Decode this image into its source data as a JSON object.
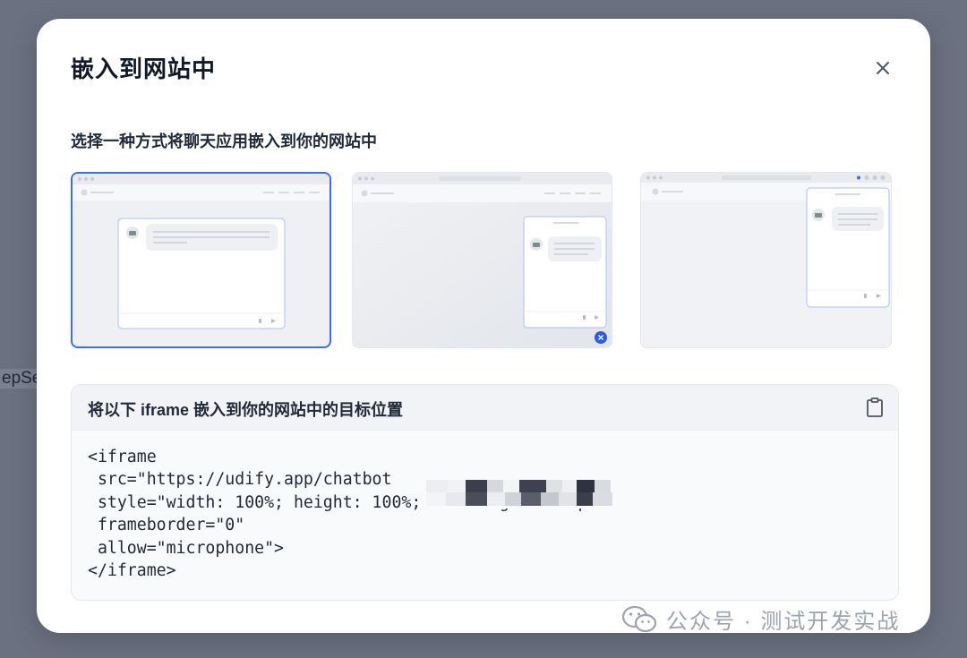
{
  "backdrop": {
    "partial_text": "epSe"
  },
  "dialog": {
    "title": "嵌入到网站中",
    "close_label": "×",
    "subtitle": "选择一种方式将聊天应用嵌入到你的网站中",
    "options": [
      {
        "selected": true,
        "kind": "full-window-iframe"
      },
      {
        "selected": false,
        "kind": "bubble-bottom-right"
      },
      {
        "selected": false,
        "kind": "chrome-extension"
      }
    ],
    "instruction_card": {
      "title": "将以下 iframe 嵌入到你的网站中的目标位置",
      "copy_icon": "clipboard-icon",
      "code_lines": [
        "<iframe",
        " src=\"https://udify.app/chatbot",
        " style=\"width: 100%; height: 100%; min-height: 700px\"",
        " frameborder=\"0\"",
        " allow=\"microphone\">",
        "</iframe>"
      ]
    }
  },
  "watermark": {
    "text": "公众号 · 测试开发实战"
  },
  "colors": {
    "accent": "#3b6ff0",
    "overlay": "#6b7180",
    "text": "#111827"
  }
}
